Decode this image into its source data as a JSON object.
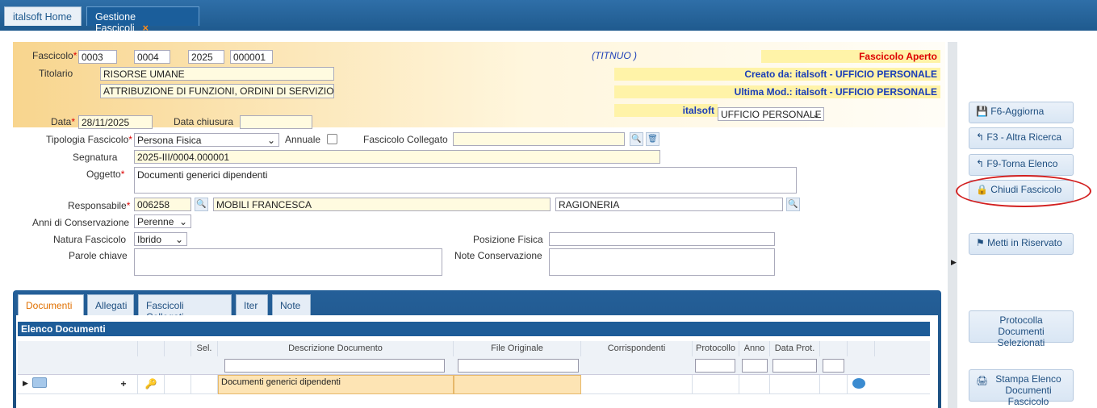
{
  "tabs": [
    {
      "label": "italsoft Home"
    },
    {
      "label": "Gestione Fascicoli",
      "close": "×"
    }
  ],
  "subtitle": "Gestione Fascicoli",
  "header": {
    "fascicolo_label": "Fascicolo",
    "fascicolo_values": [
      "0003",
      "0004",
      "2025",
      "000001"
    ],
    "titolario_label": "Titolario",
    "titolario_value": "RISORSE UMANE",
    "titolario_desc": "ATTRIBUZIONE DI FUNZIONI, ORDINI DI SERVIZIO E MISSIO",
    "titnuo": "(TITNUO )",
    "stato": "Fascicolo Aperto",
    "creato": "Creato da: italsoft - UFFICIO PERSONALE",
    "ultima_mod": "Ultima Mod.: italsoft - UFFICIO PERSONALE",
    "utente": "italsoft",
    "ufficio": "UFFICIO PERSONALE",
    "data_label": "Data",
    "data_value": "28/11/2025",
    "data_chiusura_label": "Data chiusura",
    "data_chiusura_value": ""
  },
  "form": {
    "tipologia_label": "Tipologia Fascicolo",
    "tipologia_value": "Persona Fisica",
    "annuale_label": "Annuale",
    "collegato_label": "Fascicolo Collegato",
    "collegato_value": "",
    "segnatura_label": "Segnatura",
    "segnatura_value": "2025-III/0004.000001",
    "oggetto_label": "Oggetto",
    "oggetto_value": "Documenti generici dipendenti",
    "responsabile_label": "Responsabile",
    "responsabile_code": "006258",
    "responsabile_name": "MOBILI FRANCESCA",
    "responsabile_ufficio": "RAGIONERIA",
    "anni_label": "Anni di Conservazione",
    "anni_value": "Perenne",
    "natura_label": "Natura Fascicolo",
    "natura_value": "Ibrido",
    "posizione_label": "Posizione Fisica",
    "posizione_value": "",
    "parole_label": "Parole chiave",
    "note_label": "Note Conservazione"
  },
  "grid_tabs": [
    "Documenti",
    "Allegati",
    "Fascicoli Collegati",
    "Iter",
    "Note"
  ],
  "grid": {
    "title": "Elenco Documenti",
    "columns": [
      "Sel.",
      "Descrizione Documento",
      "File Originale",
      "Corrispondenti",
      "Protocollo",
      "Anno",
      "Data Prot."
    ],
    "rows": [
      {
        "plus": "+",
        "descrizione": "Documenti generici dipendenti"
      }
    ]
  },
  "actions": {
    "aggiorna": "F6-Aggiorna",
    "altra_ricerca": "F3 - Altra Ricerca",
    "torna_elenco": "F9-Torna Elenco",
    "chiudi": "Chiudi Fascicolo",
    "riservato": "Metti in Riservato",
    "protocolla": "Protocolla Documenti Selezionati",
    "stampa": "Stampa Elenco Documenti Fascicolo"
  },
  "colors": {
    "accent": "#1f5a8e",
    "highlight": "#d21f1f",
    "yellow": "#fff3a8"
  }
}
